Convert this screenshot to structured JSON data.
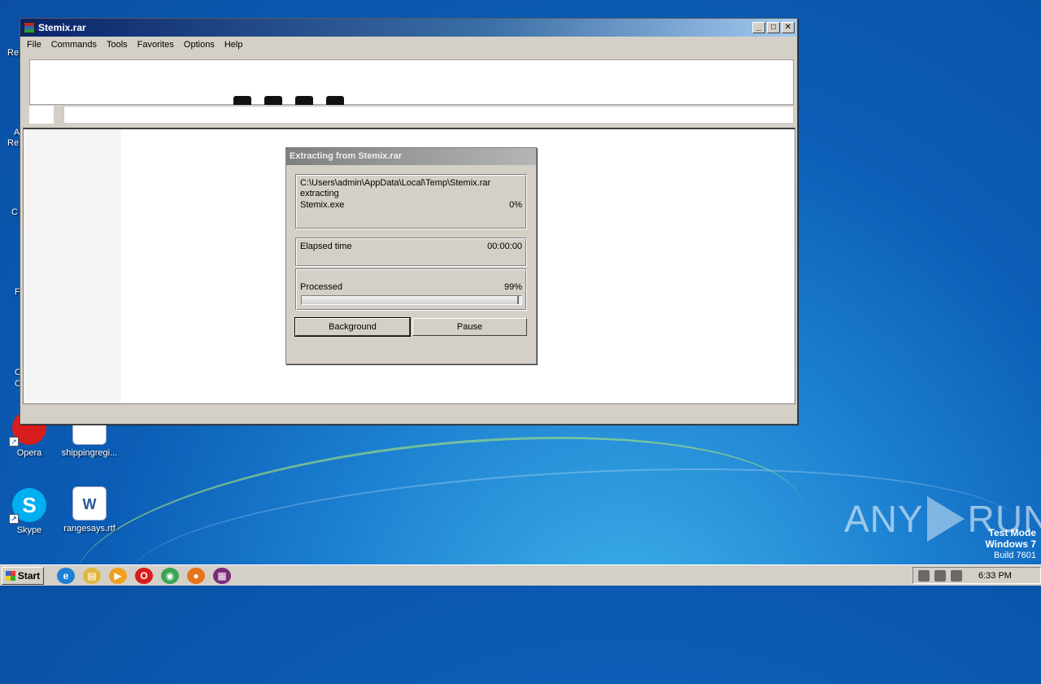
{
  "desktop": {
    "icons": [
      {
        "label": "Opera",
        "color": "#d91c1c"
      },
      {
        "label": "shippingregi...",
        "color": "#2b579a"
      },
      {
        "label": "Skype",
        "color": "#00aff0"
      },
      {
        "label": "rangesays.rtf",
        "color": "#2b579a"
      }
    ],
    "edge_fragments": [
      "Re",
      "A",
      "Re",
      "C",
      "F",
      "C",
      "C"
    ]
  },
  "window": {
    "title": "Stemix.rar",
    "menu": [
      "File",
      "Commands",
      "Tools",
      "Favorites",
      "Options",
      "Help"
    ],
    "buttons": {
      "minimize": "_",
      "maximize": "□",
      "close": "✕"
    }
  },
  "dialog": {
    "title": "Extracting from Stemix.rar",
    "archive_path": "C:\\Users\\admin\\AppData\\Local\\Temp\\Stemix.rar",
    "action": "extracting",
    "file_name": "Stemix.exe",
    "file_percent": "0%",
    "elapsed_label": "Elapsed time",
    "elapsed_value": "00:00:00",
    "processed_label": "Processed",
    "processed_value": "99%",
    "processed_fraction": 0.99,
    "background_button": "Background",
    "pause_button": "Pause"
  },
  "taskbar": {
    "start_label": "Start",
    "quick_launch": [
      {
        "name": "ie-icon",
        "color": "#1e7fd6",
        "glyph": "e"
      },
      {
        "name": "explorer-icon",
        "color": "#e0b640",
        "glyph": "▤"
      },
      {
        "name": "media-player-icon",
        "color": "#f0a020",
        "glyph": "▶"
      },
      {
        "name": "opera-icon",
        "color": "#d91c1c",
        "glyph": "O"
      },
      {
        "name": "chrome-icon",
        "color": "#3aa655",
        "glyph": "◉"
      },
      {
        "name": "firefox-icon",
        "color": "#e8731b",
        "glyph": "●"
      },
      {
        "name": "winrar-icon",
        "color": "#7a2a7a",
        "glyph": "▦"
      }
    ],
    "clock": "6:33 PM"
  },
  "watermark": {
    "brand_left": "ANY",
    "brand_right": "RUN",
    "mode": "Test Mode",
    "os": "Windows 7",
    "build": "Build 7601"
  }
}
